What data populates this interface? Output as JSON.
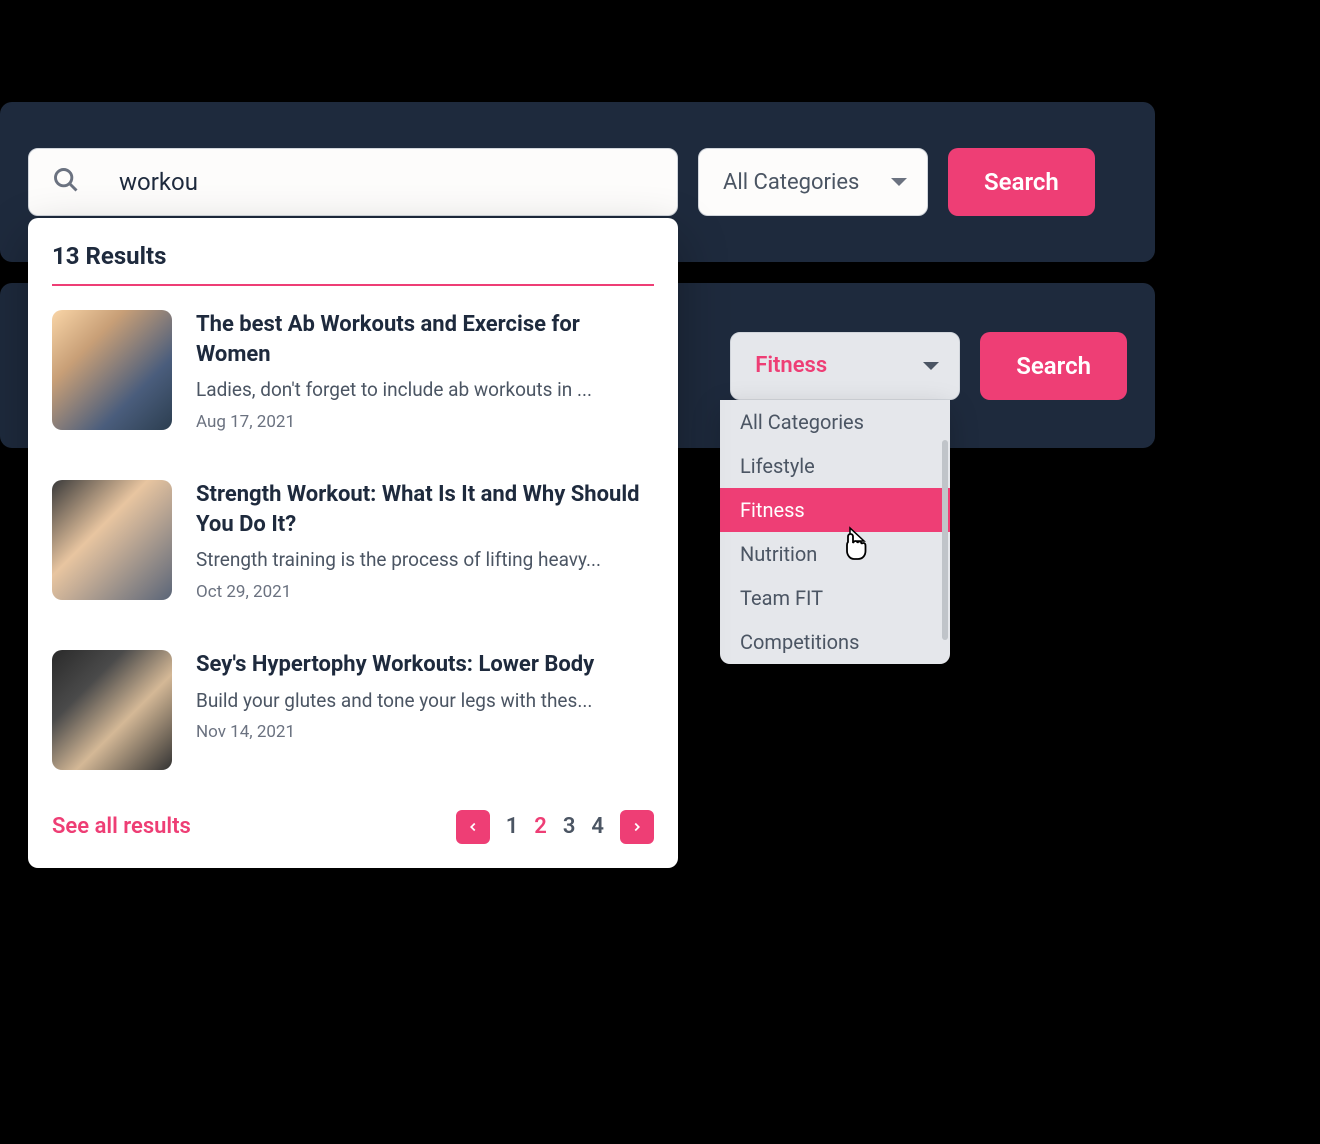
{
  "topBar": {
    "searchValue": "workou",
    "categoryLabel": "All Categories",
    "searchButton": "Search"
  },
  "results": {
    "countLabel": "13 Results",
    "items": [
      {
        "title": "The best Ab Workouts and Exercise for Women",
        "description": "Ladies, don't forget to include ab workouts in ...",
        "date": "Aug 17, 2021"
      },
      {
        "title": "Strength Workout: What Is It and Why Should You Do It?",
        "description": "Strength training is the process of lifting heavy...",
        "date": "Oct 29, 2021"
      },
      {
        "title": "Sey's Hypertophy Workouts: Lower Body",
        "description": "Build your glutes and tone your legs with thes...",
        "date": "Nov 14, 2021"
      }
    ],
    "seeAll": "See all results",
    "pagination": {
      "pages": [
        "1",
        "2",
        "3",
        "4"
      ],
      "active": "2"
    }
  },
  "secondBar": {
    "selectedCategory": "Fitness",
    "searchButton": "Search",
    "options": [
      "All Categories",
      "Lifestyle",
      "Fitness",
      "Nutrition",
      "Team FIT",
      "Competitions"
    ]
  }
}
